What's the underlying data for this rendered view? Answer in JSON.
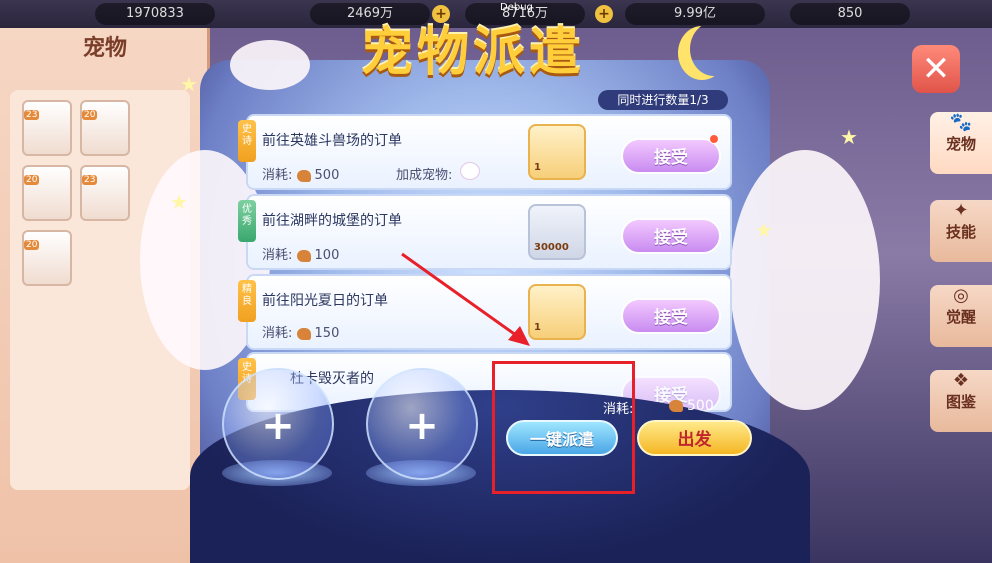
{
  "debug_label": "Debug",
  "top_resources": [
    {
      "value": "1970833",
      "icon": "gem-icon"
    },
    {
      "value": "2469万",
      "icon": "coin-icon"
    },
    {
      "value": "8716万",
      "icon": "coin-icon"
    },
    {
      "value": "9.99亿",
      "icon": "star-ticket-icon"
    },
    {
      "value": "850",
      "icon": "drumstick-icon"
    }
  ],
  "pet_panel": {
    "title": "宠物",
    "pet_levels": [
      "23",
      "20",
      "20",
      "23",
      "20"
    ]
  },
  "side_tabs": [
    {
      "label": "宠物",
      "active": true
    },
    {
      "label": "技能",
      "active": false
    },
    {
      "label": "觉醒",
      "active": false
    },
    {
      "label": "图鉴",
      "active": false
    }
  ],
  "dispatch": {
    "title": "宠物派遣",
    "concurrent_label": "同时进行数量1/3",
    "orders": [
      {
        "tag": "史诗",
        "name": "前往英雄斗兽场的订单",
        "cost_label": "消耗:",
        "cost": "500",
        "bonus_label": "加成宠物:",
        "reward_count": "1",
        "accept_label": "接受",
        "has_dot": true
      },
      {
        "tag": "优秀",
        "name": "前往湖畔的城堡的订单",
        "cost_label": "消耗:",
        "cost": "100",
        "reward_count": "30000",
        "accept_label": "接受",
        "has_dot": false
      },
      {
        "tag": "精良",
        "name": "前往阳光夏日的订单",
        "cost_label": "消耗:",
        "cost": "150",
        "reward_count": "1",
        "accept_label": "接受",
        "has_dot": false
      },
      {
        "tag": "史诗",
        "name": "杜卡毁灭者的",
        "accept_label": "接受"
      }
    ],
    "total_cost_label": "消耗:",
    "total_cost": "500",
    "one_key_label": "一键派遣",
    "go_label": "出发"
  },
  "colors": {
    "accent_gold": "#ffce3a",
    "accept_purple": "#c88cf0",
    "onekey_blue": "#4aa6e6",
    "highlight_red": "#e8202a"
  }
}
